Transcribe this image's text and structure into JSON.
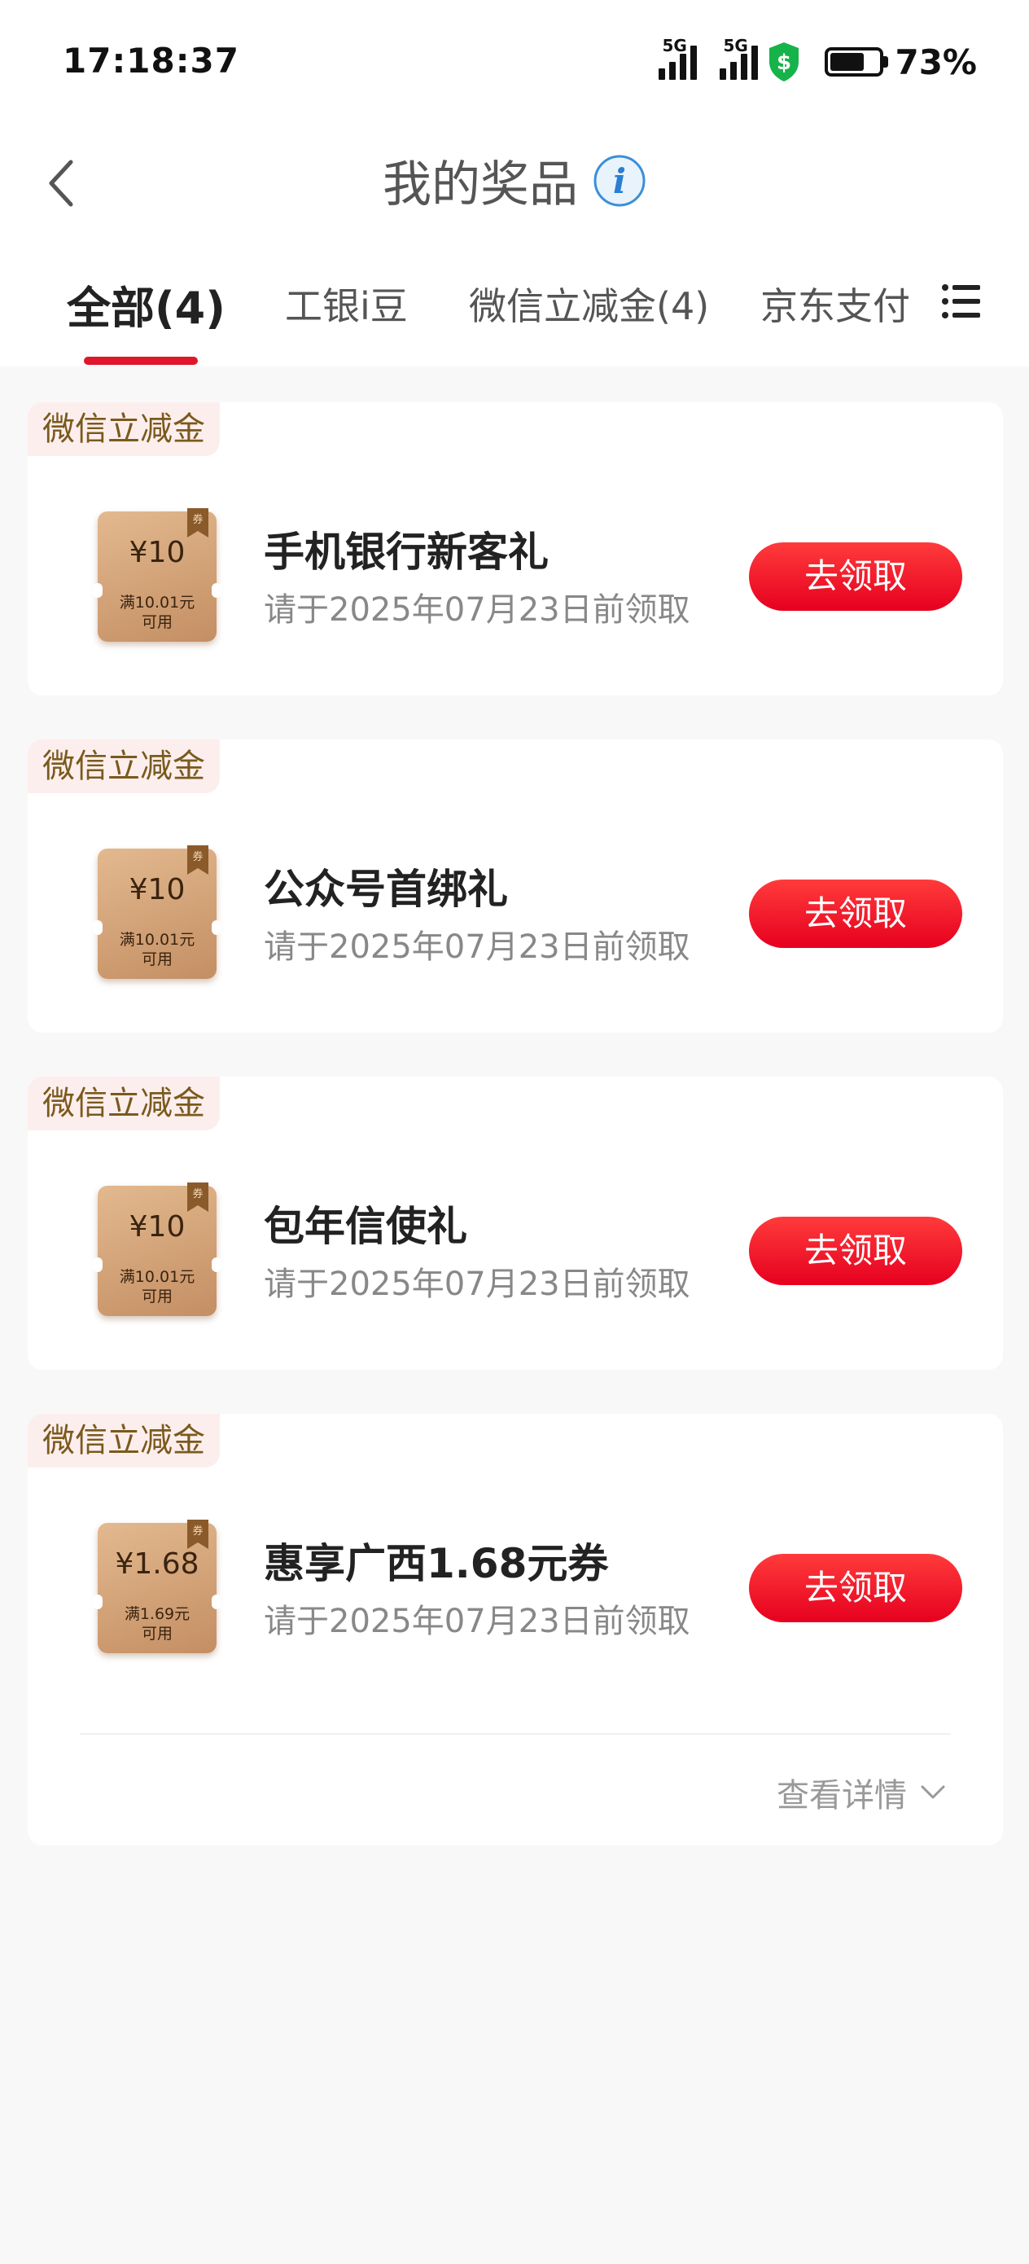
{
  "status_bar": {
    "time": "17:18:37",
    "signal1_label": "5G",
    "signal2_label": "5G",
    "battery_text": "73%",
    "battery_level": 0.73
  },
  "header": {
    "title": "我的奖品"
  },
  "tabs": [
    {
      "label": "全部(4)",
      "active": true
    },
    {
      "label": "工银i豆",
      "active": false
    },
    {
      "label": "微信立减金(4)",
      "active": false
    },
    {
      "label": "京东支付",
      "active": false
    }
  ],
  "cards": [
    {
      "tag": "微信立减金",
      "amount": "¥10",
      "cond1": "满10.01元",
      "cond2": "可用",
      "ribbon": "券",
      "name": "手机银行新客礼",
      "deadline": "请于2025年07月23日前领取",
      "button": "去领取"
    },
    {
      "tag": "微信立减金",
      "amount": "¥10",
      "cond1": "满10.01元",
      "cond2": "可用",
      "ribbon": "券",
      "name": "公众号首绑礼",
      "deadline": "请于2025年07月23日前领取",
      "button": "去领取"
    },
    {
      "tag": "微信立减金",
      "amount": "¥10",
      "cond1": "满10.01元",
      "cond2": "可用",
      "ribbon": "券",
      "name": "包年信使礼",
      "deadline": "请于2025年07月23日前领取",
      "button": "去领取"
    },
    {
      "tag": "微信立减金",
      "amount": "¥1.68",
      "cond1": "满1.69元",
      "cond2": "可用",
      "ribbon": "券",
      "name": "惠享广西1.68元券",
      "deadline": "请于2025年07月23日前领取",
      "button": "去领取"
    }
  ],
  "footer": {
    "detail_label": "查看详情"
  },
  "colors": {
    "accent": "#e0172c",
    "button": "#f00a23",
    "tag_bg": "#fdeeee",
    "tag_text": "#7a5a1c"
  }
}
